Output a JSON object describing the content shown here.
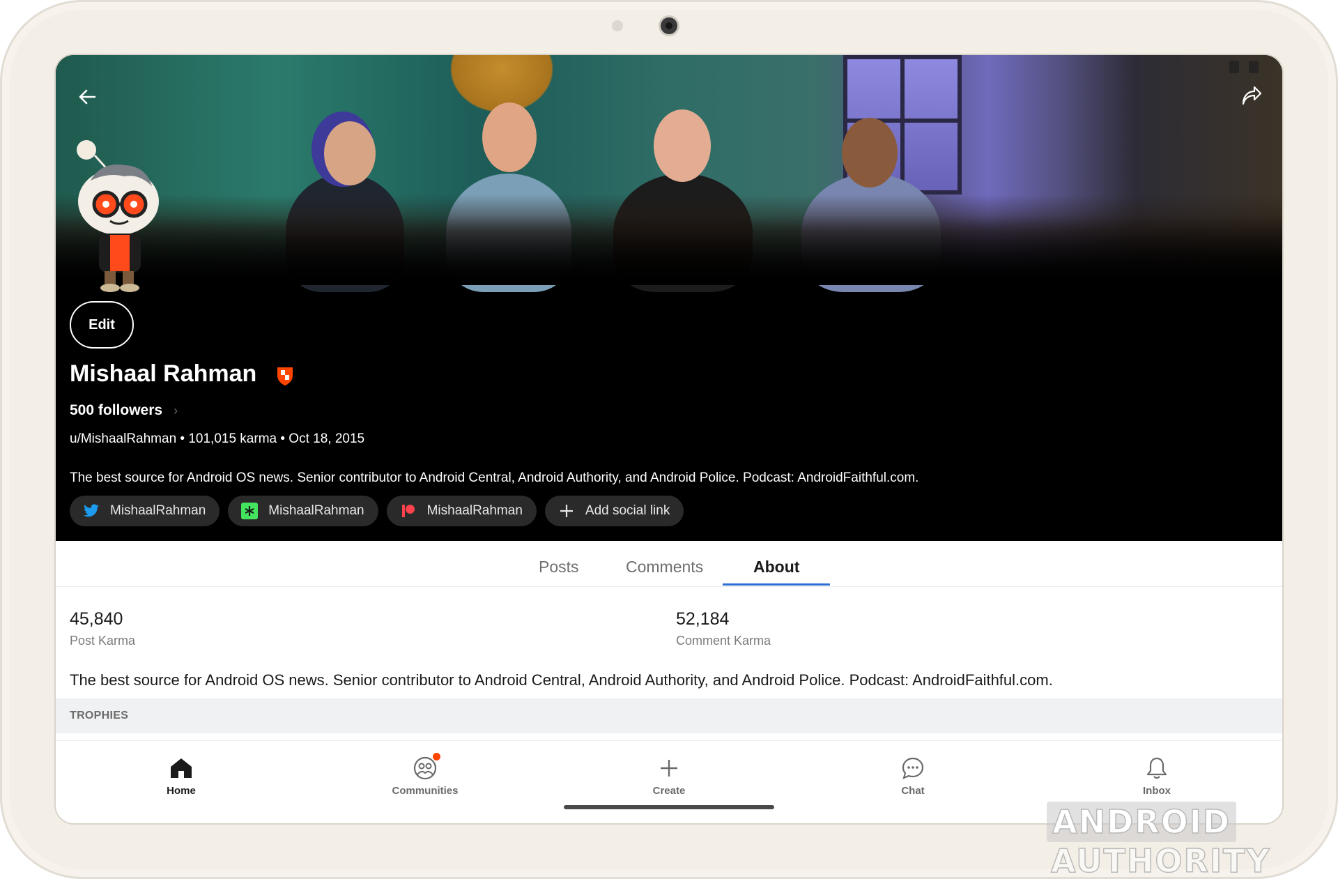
{
  "profile": {
    "edit_label": "Edit",
    "name": "Mishaal Rahman",
    "followers": "500 followers",
    "meta": "u/MishaalRahman • 101,015 karma • Oct 18, 2015",
    "bio": "The best source for Android OS news. Senior contributor to Android Central, Android Authority, and Android Police. Podcast: AndroidFaithful.com."
  },
  "social_links": [
    {
      "label": "MishaalRahman",
      "icon": "twitter-icon",
      "color": "#1d9bf0"
    },
    {
      "label": "MishaalRahman",
      "icon": "linktree-icon",
      "color": "#43e55e"
    },
    {
      "label": "MishaalRahman",
      "icon": "patreon-icon",
      "color": "#ff424d"
    },
    {
      "label": "Add social link",
      "icon": "plus-icon"
    }
  ],
  "tabs": [
    {
      "label": "Posts"
    },
    {
      "label": "Comments"
    },
    {
      "label": "About",
      "active": true
    }
  ],
  "about": {
    "post_karma_value": "45,840",
    "post_karma_label": "Post Karma",
    "comment_karma_value": "52,184",
    "comment_karma_label": "Comment Karma",
    "description": "The best source for Android OS news. Senior contributor to Android Central, Android Authority, and Android Police. Podcast: AndroidFaithful.com.",
    "trophies_label": "TROPHIES"
  },
  "bottom_nav": [
    {
      "label": "Home",
      "icon": "home-icon",
      "active": true
    },
    {
      "label": "Communities",
      "icon": "communities-icon",
      "badge": true
    },
    {
      "label": "Create",
      "icon": "plus-icon"
    },
    {
      "label": "Chat",
      "icon": "chat-icon"
    },
    {
      "label": "Inbox",
      "icon": "bell-icon"
    }
  ],
  "watermark": {
    "part1": "ANDROID",
    "part2": "AUTHORITY"
  },
  "colors": {
    "accent": "#2b6fd3",
    "brand": "#ff4500",
    "header_bg": "#000000"
  }
}
